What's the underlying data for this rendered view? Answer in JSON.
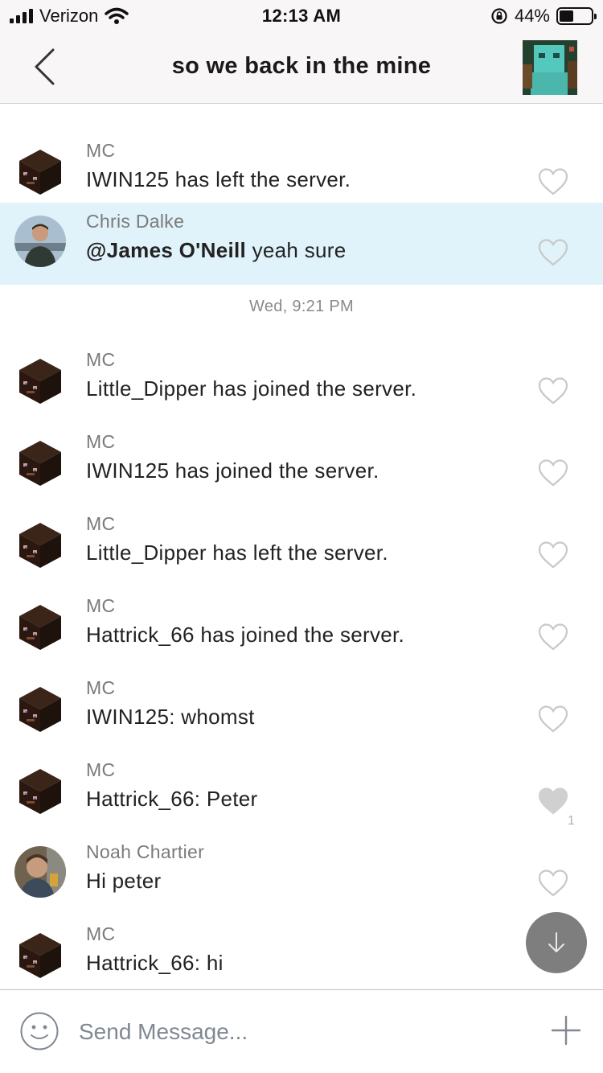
{
  "status_bar": {
    "carrier": "Verizon",
    "time": "12:13 AM",
    "battery": "44%",
    "battery_level": 0.44
  },
  "nav": {
    "title": "so we back in the mine"
  },
  "messages_before": [
    {
      "sender": "MC",
      "avatar": "minecraft-head",
      "text": "IWIN125 has left the server.",
      "liked": false
    },
    {
      "sender": "Chris Dalke",
      "avatar": "photo",
      "mention": "@James O'Neill",
      "text": " yeah sure",
      "liked": false,
      "highlighted": true
    }
  ],
  "date_separator": "Wed, 9:21 PM",
  "messages_after": [
    {
      "sender": "MC",
      "avatar": "minecraft-head",
      "text": "Little_Dipper has joined the server.",
      "liked": false
    },
    {
      "sender": "MC",
      "avatar": "minecraft-head",
      "text": "IWIN125 has joined the server.",
      "liked": false
    },
    {
      "sender": "MC",
      "avatar": "minecraft-head",
      "text": "Little_Dipper has left the server.",
      "liked": false
    },
    {
      "sender": "MC",
      "avatar": "minecraft-head",
      "text": "Hattrick_66 has joined the server.",
      "liked": false
    },
    {
      "sender": "MC",
      "avatar": "minecraft-head",
      "text": "IWIN125: whomst",
      "liked": false
    },
    {
      "sender": "MC",
      "avatar": "minecraft-head",
      "text": "Hattrick_66: Peter",
      "liked": true,
      "like_count": "1"
    },
    {
      "sender": "Noah Chartier",
      "avatar": "photo",
      "text": "Hi peter",
      "liked": false
    },
    {
      "sender": "MC",
      "avatar": "minecraft-head",
      "text": "Hattrick_66: hi",
      "liked": false
    }
  ],
  "composer": {
    "placeholder": "Send Message..."
  },
  "icons": {
    "back": "chevron-left-icon",
    "like": "heart-icon",
    "scroll_down": "arrow-down-icon",
    "emoji": "smiley-icon",
    "add": "plus-icon"
  },
  "colors": {
    "highlight": "#e0f2fa",
    "heart_outline": "#c8c8c8",
    "heart_filled": "#d0d0d0",
    "scroll_button": "#7e7e7e",
    "composer_icon": "#7f8892"
  }
}
